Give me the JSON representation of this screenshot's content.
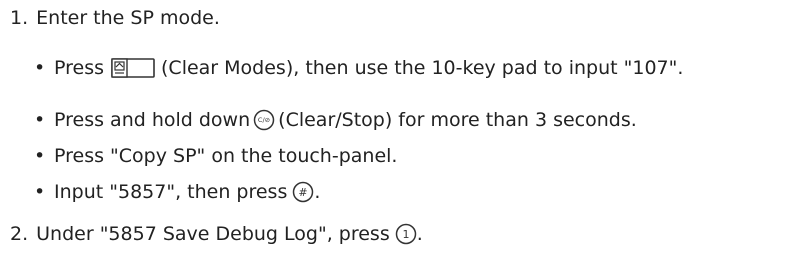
{
  "steps": [
    {
      "number": "1.",
      "text": "Enter the SP mode.",
      "substeps": [
        {
          "bullet": "•",
          "before": "Press",
          "icon": "clear-modes-key-icon",
          "after": "(Clear Modes), then use the 10-key pad to input \"107\"."
        },
        {
          "bullet": "•",
          "before": "Press and hold down",
          "icon": "clear-stop-key-icon",
          "after": "(Clear/Stop) for more than 3 seconds."
        },
        {
          "bullet": "•",
          "text": "Press \"Copy SP\" on the touch-panel."
        },
        {
          "bullet": "•",
          "before": "Input \"5857\", then press",
          "icon": "hash-key-icon",
          "after": "."
        }
      ]
    },
    {
      "number": "2.",
      "before": "Under \"5857 Save Debug Log\", press",
      "icon": "one-key-icon",
      "after": "."
    }
  ]
}
